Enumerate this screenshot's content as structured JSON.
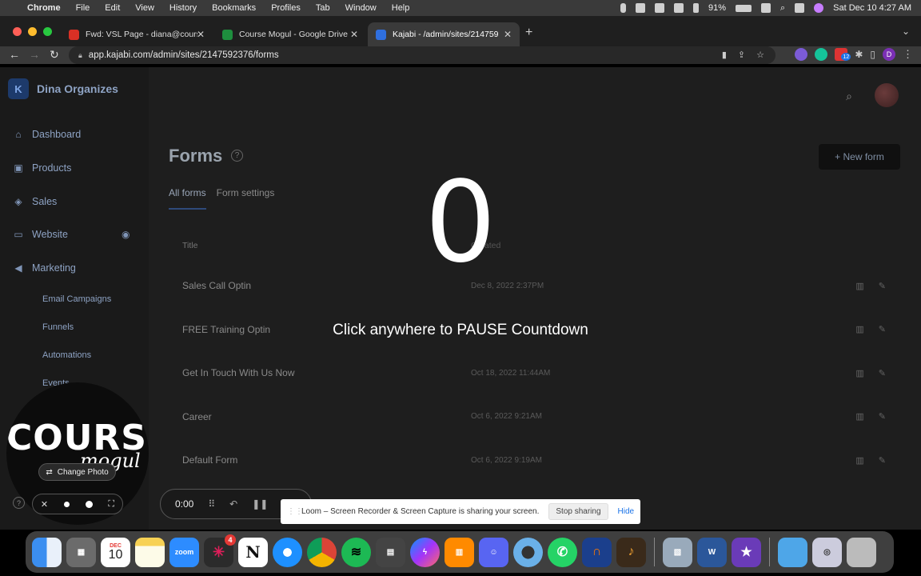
{
  "menubar": {
    "app": "Chrome",
    "items": [
      "File",
      "Edit",
      "View",
      "History",
      "Bookmarks",
      "Profiles",
      "Tab",
      "Window",
      "Help"
    ],
    "battery": "91%",
    "datetime": "Sat Dec 10  4:27 AM"
  },
  "browser": {
    "tabs": [
      {
        "title": "Fwd: VSL Page - diana@cours",
        "color": "#d93025"
      },
      {
        "title": "Course Mogul - Google Drive",
        "color": "#1e8e3e"
      },
      {
        "title": "Kajabi - /admin/sites/214759",
        "color": "#2f6fdf"
      }
    ],
    "url": "app.kajabi.com/admin/sites/2147592376/forms",
    "profile_initial": "D",
    "ext_badge": "12"
  },
  "sidebar": {
    "site_name": "Dina Organizes",
    "items": [
      {
        "label": "Dashboard",
        "icon": "home-icon"
      },
      {
        "label": "Products",
        "icon": "box-icon"
      },
      {
        "label": "Sales",
        "icon": "tag-icon"
      },
      {
        "label": "Website",
        "icon": "monitor-icon"
      },
      {
        "label": "Marketing",
        "icon": "megaphone-icon"
      }
    ],
    "subitems": [
      "Email Campaigns",
      "Funnels",
      "Automations",
      "Events"
    ]
  },
  "main": {
    "title": "Forms",
    "new_button": "+ New form",
    "tabs": [
      "All forms",
      "Form settings"
    ],
    "columns": [
      "Title",
      "Created"
    ],
    "rows": [
      {
        "title": "Sales Call Optin",
        "date": "Dec 8, 2022 2:37PM"
      },
      {
        "title": "FREE Training Optin",
        "date": ""
      },
      {
        "title": "Get In Touch With Us Now",
        "date": "Oct 18, 2022 11:44AM"
      },
      {
        "title": "Career",
        "date": "Oct 6, 2022 9:21AM"
      },
      {
        "title": "Default Form",
        "date": "Oct 6, 2022 9:19AM"
      }
    ]
  },
  "overlay": {
    "countdown": "0",
    "hint": "Click anywhere to PAUSE Countdown"
  },
  "camera": {
    "logo_top": "COURSE",
    "logo_bottom": "mogul",
    "change_photo": "Change Photo"
  },
  "recorder": {
    "time": "0:00"
  },
  "share_bar": {
    "message": "Loom – Screen Recorder & Screen Capture is sharing your screen.",
    "stop": "Stop sharing",
    "hide": "Hide"
  },
  "dock": {
    "calendar_month": "DEC",
    "calendar_day": "10",
    "zoom_label": "zoom",
    "slack_badge": "4",
    "notion_label": "N"
  }
}
